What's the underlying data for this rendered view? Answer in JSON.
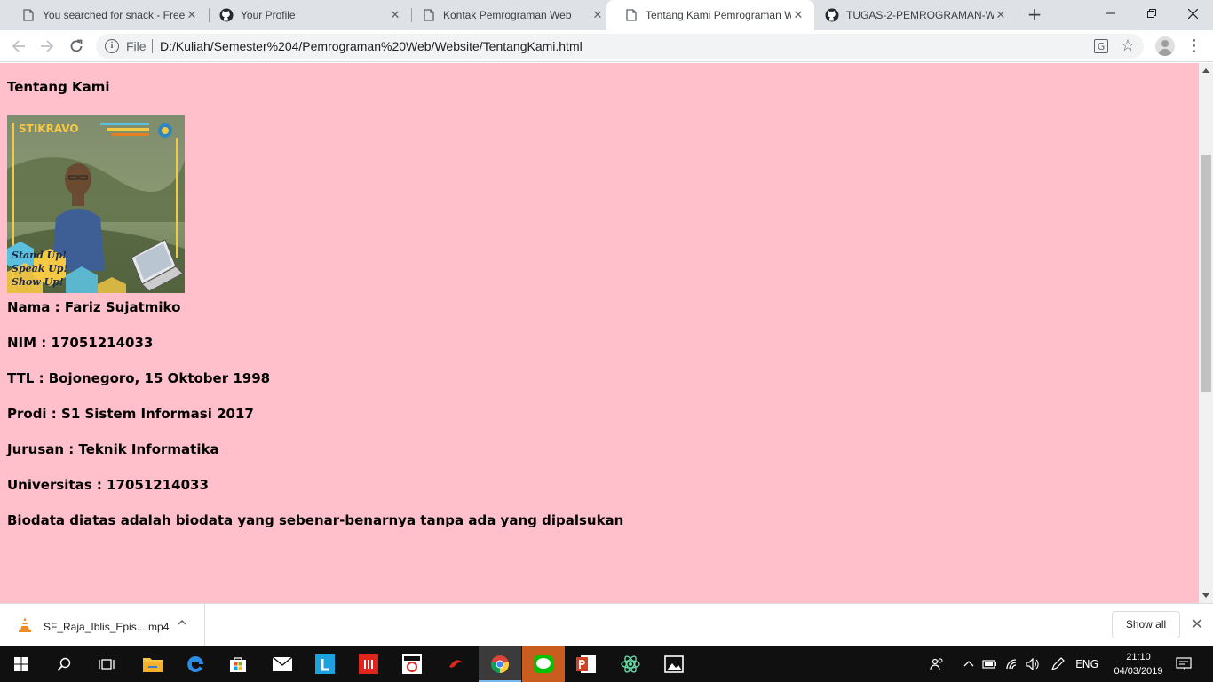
{
  "browser": {
    "tabs": [
      {
        "title": "You searched for snack - Free F",
        "favicon": "document-icon",
        "active": false
      },
      {
        "title": "Your Profile",
        "favicon": "github-icon",
        "active": false
      },
      {
        "title": "Kontak Pemrograman Web",
        "favicon": "document-icon",
        "active": false
      },
      {
        "title": "Tentang Kami Pemrograman W",
        "favicon": "document-icon",
        "active": true
      },
      {
        "title": "TUGAS-2-PEMROGRAMAN-W",
        "favicon": "github-icon",
        "active": false
      }
    ],
    "address": {
      "scheme_label": "File",
      "url": "D:/Kuliah/Semester%204/Pemrograman%20Web/Website/TentangKami.html"
    }
  },
  "page": {
    "background": "#ffc0cb",
    "heading": "Tentang Kami",
    "photo": {
      "banner_text": "STIKRAVO",
      "slogan": [
        "Stand Up!",
        "Speak Up!",
        "Show Up!"
      ]
    },
    "fields": [
      "Nama : Fariz Sujatmiko",
      "NIM : 17051214033",
      "TTL : Bojonegoro, 15 Oktober 1998",
      "Prodi : S1 Sistem Informasi 2017",
      "Jurusan : Teknik Informatika",
      "Universitas : 17051214033",
      "Biodata diatas adalah biodata yang sebenar-benarnya tanpa ada yang dipalsukan"
    ]
  },
  "downloads": {
    "item_name": "SF_Raja_Iblis_Epis....mp4",
    "show_all_label": "Show all"
  },
  "taskbar": {
    "language": "ENG",
    "time": "21:10",
    "date": "04/03/2019"
  }
}
